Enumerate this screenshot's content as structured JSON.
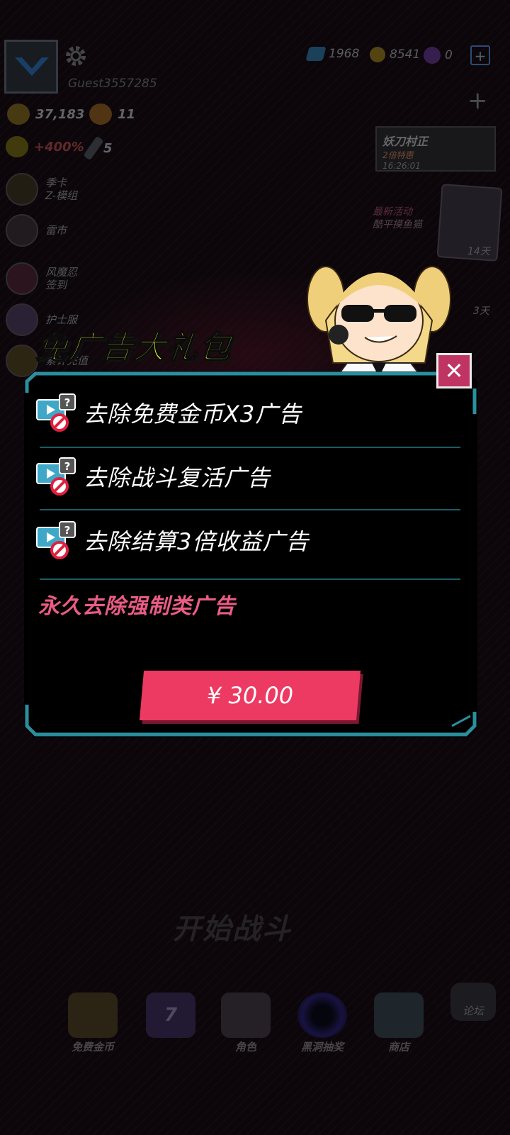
{
  "header": {
    "username": "Guest3557285",
    "resources": [
      {
        "icon": "diamond-icon",
        "value": "1968",
        "color": "#3f9ad6"
      },
      {
        "icon": "coin-icon",
        "value": "8541",
        "color": "#d9a81e"
      },
      {
        "icon": "crystal-icon",
        "value": "0",
        "color": "#9b4fd8"
      }
    ],
    "trophy_count": "37,183",
    "medal_count": "11",
    "boost": "+400%",
    "sword_count": "5"
  },
  "sidebar": {
    "items": [
      {
        "icon": "season-card-icon",
        "line1": "季卡",
        "line2": "Z-模组"
      },
      {
        "icon": "ace-coin-icon",
        "line1": "雷市",
        "line2": ""
      },
      {
        "icon": "wind-ninja-icon",
        "line1": "风魔忍",
        "line2": "签到"
      },
      {
        "icon": "nurse-outfit-icon",
        "line1": "护士服",
        "line2": ""
      },
      {
        "icon": "recharge-icon",
        "line1": "累计充值",
        "line2": ""
      }
    ]
  },
  "events": {
    "banner_title": "妖刀村正",
    "banner_subtitle": "2倍特惠",
    "banner_timer": "16:26:01",
    "event2_line1": "最新活动",
    "event2_line2": "酷平摸鱼猫",
    "days_1": "14天",
    "days_2": "3天"
  },
  "popup": {
    "title": "免广告大礼包",
    "close_symbol": "✕",
    "benefits": [
      "去除免费金币X3广告",
      "去除战斗复活广告",
      "去除结算3倍收益广告"
    ],
    "permanent_note": "永久去除强制类广告",
    "price": "¥ 30.00"
  },
  "bottom": {
    "start_battle": "开始战斗",
    "nav": [
      {
        "label": "免费金币"
      },
      {
        "label": "7"
      },
      {
        "label": "角色"
      },
      {
        "label": "黑洞抽奖"
      },
      {
        "label": "商店"
      }
    ],
    "forum": "论坛"
  },
  "colors": {
    "title_yellow": "#e9ee2c",
    "accent_pink": "#ec3a62",
    "permanent_pink": "#ea5c84",
    "frame_teal": "#2a8f9e",
    "close_bg": "#bf3462"
  }
}
